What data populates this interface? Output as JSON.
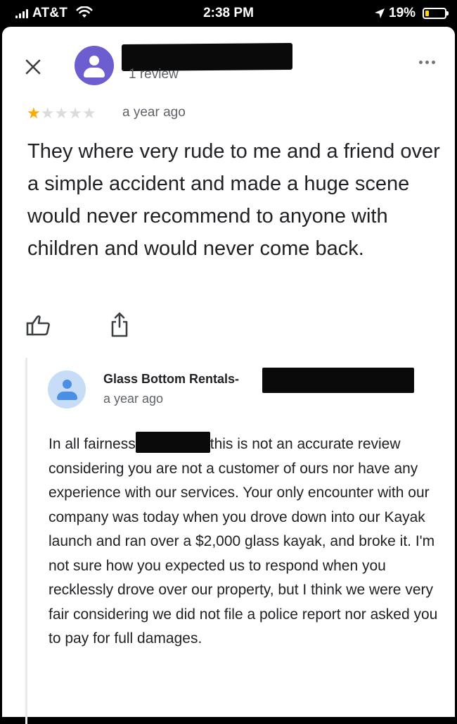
{
  "status_bar": {
    "carrier": "AT&T",
    "time": "2:38 PM",
    "battery_percent": "19%",
    "battery_level": 0.19,
    "battery_color": "#ffd60a",
    "icons": [
      "signal-icon",
      "wifi-icon",
      "location-arrow-icon",
      "battery-icon"
    ]
  },
  "review": {
    "reviewer_meta": "1 review",
    "rating": 1,
    "rating_max": 5,
    "star_color": "#f9ab00",
    "time": "a year ago",
    "text": "They where very rude to me and a friend over a simple accident and made a huge scene would never recommend to anyone with children and would never come back.",
    "actions": [
      "thumbs-up-icon",
      "share-icon"
    ]
  },
  "owner_response": {
    "name": "Glass Bottom Rentals-",
    "time": "a year ago",
    "text_before": "In all fairness",
    "text_after": "this is not an accurate review considering you are not a customer of ours nor have any experience with our services. Your only encounter with our company was today when you drove down into our Kayak launch and ran over a $2,000 glass kayak, and broke it. I'm not sure how you expected us to respond when  you recklessly drove over our property, but I think we were very fair considering we did not file a police report nor asked you to pay for full damages."
  }
}
